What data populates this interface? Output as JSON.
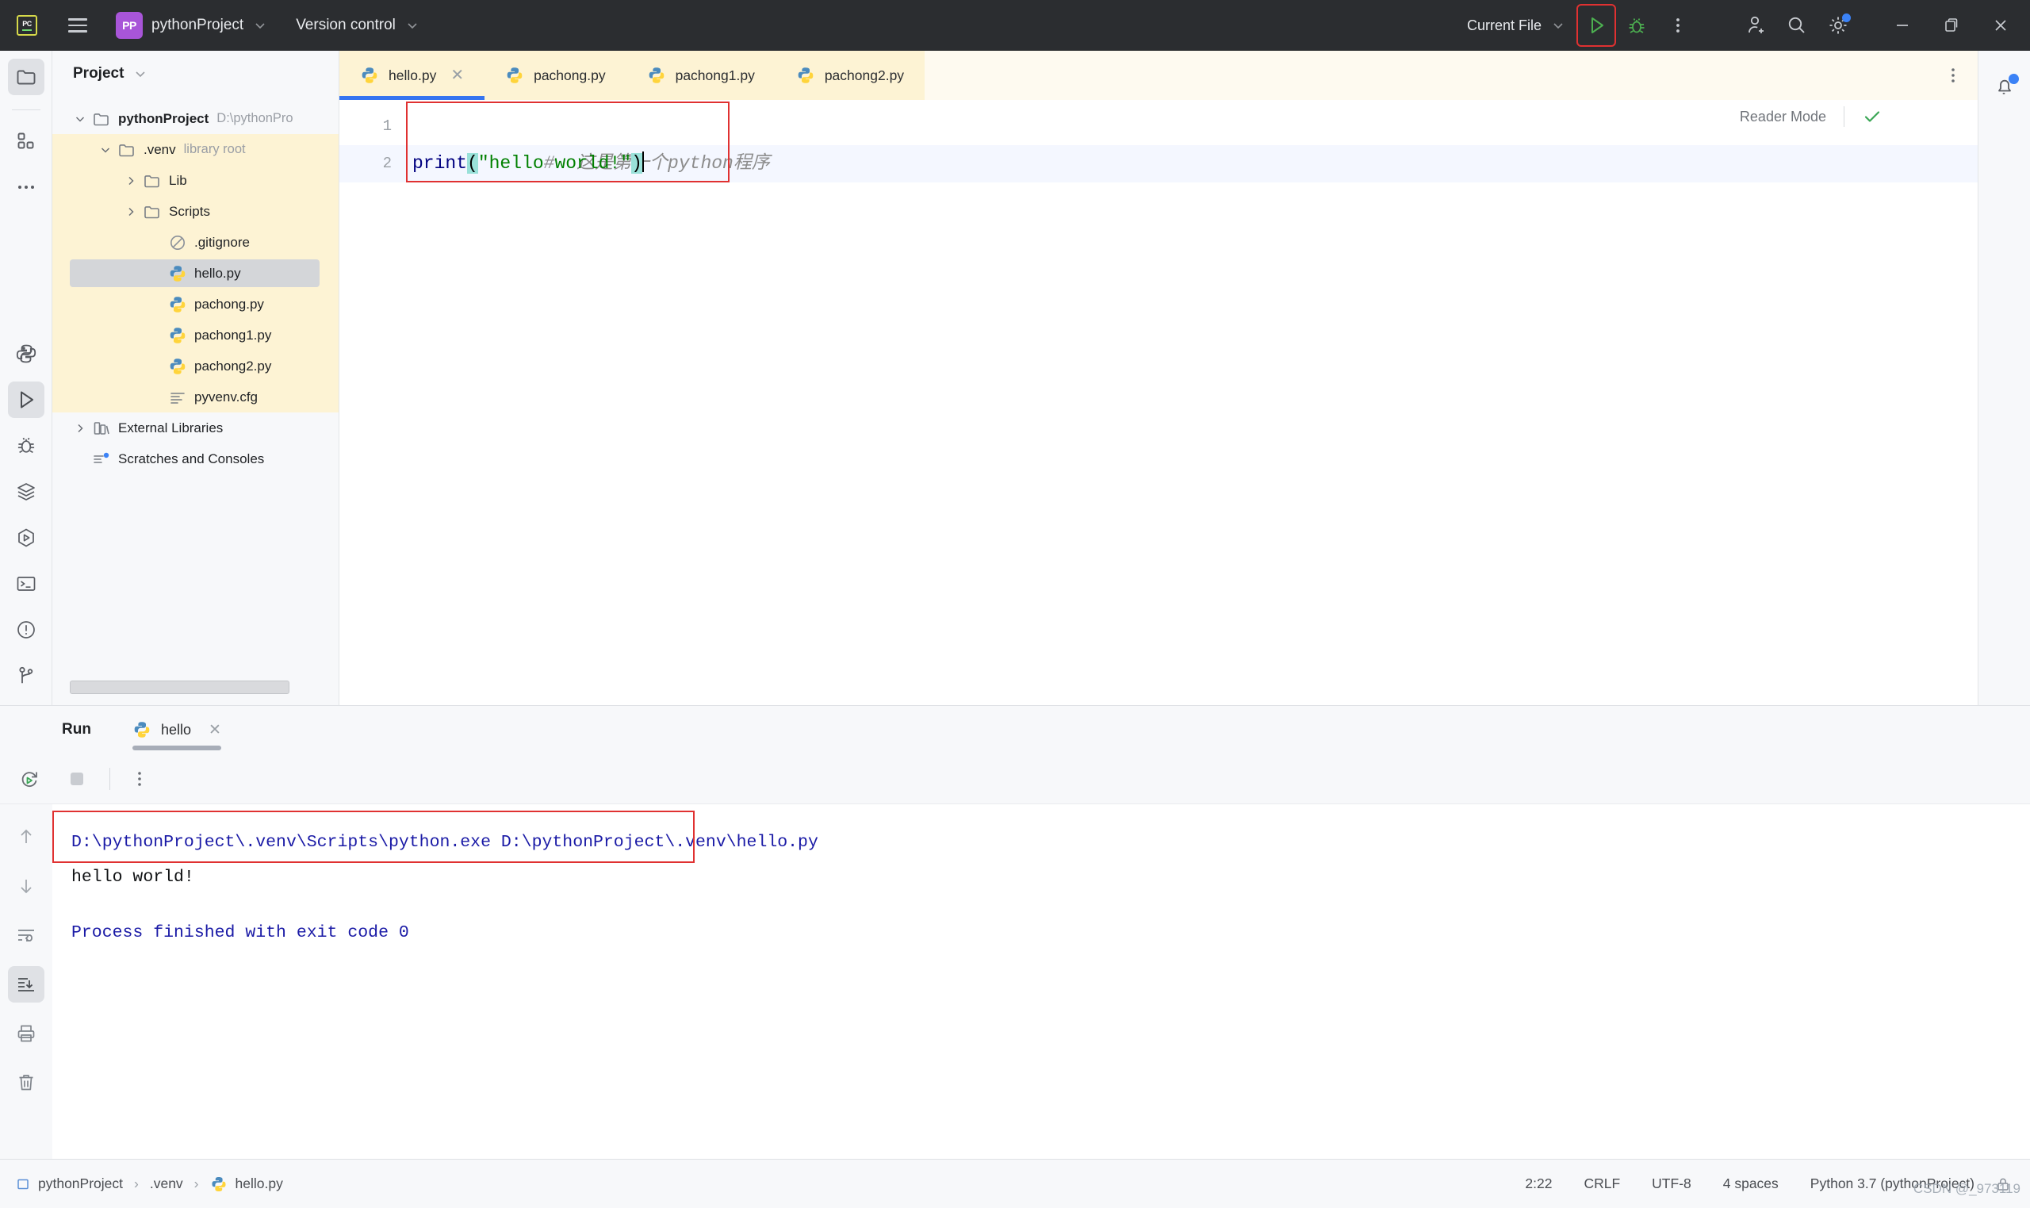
{
  "titlebar": {
    "ide_icon": "pycharm-logo-icon",
    "pc_text": "PC",
    "menu_icon": "hamburger-menu-icon",
    "project_badge": "PP",
    "project_name": "pythonProject",
    "version_control": "Version control",
    "run_config": "Current File",
    "run_icon": "run-triangle-icon",
    "debug_icon": "debug-bug-icon",
    "more_icon": "more-vertical-icon",
    "account_icon": "add-user-icon",
    "search_icon": "search-icon",
    "settings_icon": "gear-icon",
    "minimize_icon": "minimize-icon",
    "maximize_icon": "restore-window-icon",
    "close_icon": "close-icon",
    "accent_run_green": "#4caf50",
    "highlight_red": "#e03131",
    "titlebar_bg": "#2b2d30"
  },
  "left_rail": {
    "top": [
      {
        "name": "project-folder-icon",
        "selected": true
      },
      {
        "name": "structure-grid-icon",
        "selected": false
      },
      {
        "name": "more-dots-icon",
        "selected": false
      }
    ],
    "bottom": [
      {
        "name": "python-console-icon",
        "selected": false
      },
      {
        "name": "run-icon",
        "selected": true
      },
      {
        "name": "debug-bug-icon",
        "selected": false
      },
      {
        "name": "services-layers-icon",
        "selected": false
      },
      {
        "name": "endpoints-icon",
        "selected": false
      },
      {
        "name": "terminal-icon",
        "selected": false
      },
      {
        "name": "problems-warning-icon",
        "selected": false
      },
      {
        "name": "git-branch-icon",
        "selected": false
      }
    ]
  },
  "project": {
    "title": "Project",
    "chevron_icon": "chevron-down-icon",
    "tree": [
      {
        "label": "pythonProject",
        "sub": "D:\\pythonPro",
        "icon": "folder-icon",
        "arrow": "expanded",
        "indent": 0,
        "bold": true,
        "selected": false,
        "band": false
      },
      {
        "label": ".venv",
        "sub": "library root",
        "icon": "folder-icon",
        "arrow": "expanded",
        "indent": 1,
        "bold": false,
        "selected": false,
        "band": true
      },
      {
        "label": "Lib",
        "sub": "",
        "icon": "folder-icon",
        "arrow": "collapsed",
        "indent": 2,
        "bold": false,
        "selected": false,
        "band": true
      },
      {
        "label": "Scripts",
        "sub": "",
        "icon": "folder-icon",
        "arrow": "collapsed",
        "indent": 2,
        "bold": false,
        "selected": false,
        "band": true
      },
      {
        "label": ".gitignore",
        "sub": "",
        "icon": "gitignore-icon",
        "arrow": "none",
        "indent": 3,
        "bold": false,
        "selected": false,
        "band": true
      },
      {
        "label": "hello.py",
        "sub": "",
        "icon": "python-file-icon",
        "arrow": "none",
        "indent": 3,
        "bold": false,
        "selected": true,
        "band": true
      },
      {
        "label": "pachong.py",
        "sub": "",
        "icon": "python-file-icon",
        "arrow": "none",
        "indent": 3,
        "bold": false,
        "selected": false,
        "band": true
      },
      {
        "label": "pachong1.py",
        "sub": "",
        "icon": "python-file-icon",
        "arrow": "none",
        "indent": 3,
        "bold": false,
        "selected": false,
        "band": true
      },
      {
        "label": "pachong2.py",
        "sub": "",
        "icon": "python-file-icon",
        "arrow": "none",
        "indent": 3,
        "bold": false,
        "selected": false,
        "band": true
      },
      {
        "label": "pyvenv.cfg",
        "sub": "",
        "icon": "config-file-icon",
        "arrow": "none",
        "indent": 3,
        "bold": false,
        "selected": false,
        "band": true
      },
      {
        "label": "External Libraries",
        "sub": "",
        "icon": "libraries-icon",
        "arrow": "collapsed",
        "indent": 0,
        "bold": false,
        "selected": false,
        "band": false
      },
      {
        "label": "Scratches and Consoles",
        "sub": "",
        "icon": "scratches-icon",
        "arrow": "none",
        "indent": 0,
        "bold": false,
        "selected": false,
        "band": false
      }
    ]
  },
  "tabs": {
    "items": [
      {
        "label": "hello.py",
        "icon": "python-file-icon",
        "active": true,
        "close_icon": "close-icon"
      },
      {
        "label": "pachong.py",
        "icon": "python-file-icon",
        "active": false
      },
      {
        "label": "pachong1.py",
        "icon": "python-file-icon",
        "active": false
      },
      {
        "label": "pachong2.py",
        "icon": "python-file-icon",
        "active": false
      }
    ],
    "more_icon": "more-vertical-icon"
  },
  "editor": {
    "line_numbers": [
      "1",
      "2"
    ],
    "line1_comment": "#  这是第一个python程序",
    "line2": {
      "keyword": "print",
      "open_paren": "(",
      "string": "\"hello world!\"",
      "close_paren": ")"
    },
    "reader_mode_label": "Reader Mode",
    "reader_mode_check_icon": "check-mark-icon",
    "inspection_ok_icon": "check-mark-icon",
    "comment_color": "#8c8c8c",
    "keyword_color": "#000080",
    "string_color": "#008000",
    "brace_highlight_color": "#99e1d9"
  },
  "right_rail": {
    "notifications_icon": "bell-notification-icon",
    "badge_color": "#3b82f6"
  },
  "run_panel": {
    "title": "Run",
    "tab_label": "hello",
    "tab_icon": "python-file-icon",
    "tab_close_icon": "close-icon",
    "toolbar": [
      {
        "name": "rerun-icon"
      },
      {
        "name": "stop-icon"
      },
      {
        "name": "more-vertical-icon"
      }
    ],
    "side_actions": [
      {
        "name": "up-arrow-icon",
        "selected": false
      },
      {
        "name": "down-arrow-icon",
        "selected": false
      },
      {
        "name": "soft-wrap-icon",
        "selected": false
      },
      {
        "name": "scroll-to-end-icon",
        "selected": true
      },
      {
        "name": "print-icon",
        "selected": false
      },
      {
        "name": "clear-all-trash-icon",
        "selected": false
      }
    ],
    "console": {
      "command_line": "D:\\pythonProject\\.venv\\Scripts\\python.exe D:\\pythonProject\\.venv\\hello.py",
      "output_line": "hello world!",
      "exit_line": "Process finished with exit code 0",
      "command_color": "#1a1aa6",
      "output_color": "#101214"
    }
  },
  "statusbar": {
    "breadcrumbs": [
      {
        "label": "pythonProject",
        "icon": "module-icon"
      },
      {
        "label": ".venv",
        "icon": "none"
      },
      {
        "label": "hello.py",
        "icon": "python-file-icon"
      }
    ],
    "separator": "›",
    "caret_position": "2:22",
    "line_separator": "CRLF",
    "encoding": "UTF-8",
    "indent": "4 spaces",
    "interpreter": "Python 3.7 (pythonProject)",
    "lock_icon": "lock-icon",
    "watermark": "CSDN @_973119"
  }
}
